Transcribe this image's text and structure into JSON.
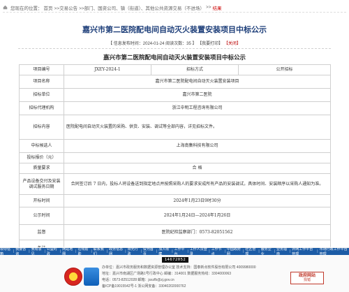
{
  "breadcrumb": {
    "prefix": "您现在的位置：",
    "items": [
      "首页",
      ">>交易公告",
      ">>部门、国资公司、镇（街道）、其他公共资源交易（不进场）",
      ">>"
    ],
    "current": "结果"
  },
  "announcement": {
    "title": "嘉兴市第二医院配电间自动灭火装置安装项目中标公示",
    "meta_info": "【 信息发布时间：2024-01-24 阅读次数：35 】",
    "print_label": "【我要打印】",
    "close_label": "【关闭】"
  },
  "table": {
    "title": "嘉兴市第二医院配电间自动灭火装置安装项目中标公示",
    "rows": [
      {
        "label": "项目编号",
        "value": "JXEY-2024-1",
        "label2": "招标方式",
        "value2": "公开招标"
      },
      {
        "label": "项目名称",
        "value": "嘉兴市第二医院配电间自动灭火装置安装项目"
      },
      {
        "label": "招标单位",
        "value": "嘉兴市第二医院"
      },
      {
        "label": "招标代理机构",
        "value": "浙江中明工程咨询有限公司"
      },
      {
        "label": "招标内容",
        "value": "医院配电间自动灭火装置的采购、供货、安装、调试等全部内容，详见招标文件。"
      },
      {
        "label": "中标候选人",
        "value": "上海南集科技有限公司"
      },
      {
        "label": "投标报价（元）",
        "value": ""
      },
      {
        "label": "质量要求",
        "value": "合    格"
      },
      {
        "label": "产品设备交付及安装调试服务日期",
        "value": "合同签订后 7 日内，投标人将设备送到指定地点并按照采购人的要求安成所有产品的安装调试，具体时间、安装顺序以采购人通知为准。"
      },
      {
        "label": "开标时间",
        "value": "2024年1月23日9时30分"
      },
      {
        "label": "公示时间",
        "value": "2024年1月24日—2024年1月26日"
      },
      {
        "label": "监督",
        "value": "医院纪检监察部门：0573-82051562"
      },
      {
        "label": "备注",
        "value": ""
      }
    ]
  },
  "footer": {
    "nav": [
      "领导信箱",
      "我要咨询",
      "我有意见",
      "公益时政",
      "网站地图",
      "在线帮助",
      "联系我们",
      "政务信息网",
      "阳光行政",
      "设为首页",
      "加入收藏",
      "工作平台",
      "工作人员登录",
      "工作节点",
      "中国政府网",
      "社区管理",
      "服务企业",
      "业务指南",
      "外网工作平台管理",
      "市场行政工作平台管理"
    ],
    "visit_count": "14672052",
    "sponsor": "办单位：嘉兴市政务服务和数据资源管理办公室    技术支持：国泰新点软件股份有限公司 4009980000",
    "address": "地址：嘉兴市南湖区广场路1号行政中心  邮编：314001    数据服务热线：3304000063",
    "phone": "电话：0573-82512028         邮箱：jsxzfb@zj.gov.cn",
    "icp": "备ICP备19015542号-1       浙公网安备：33040202000762",
    "badge_title": "政府网站",
    "badge_sub": "找错"
  }
}
